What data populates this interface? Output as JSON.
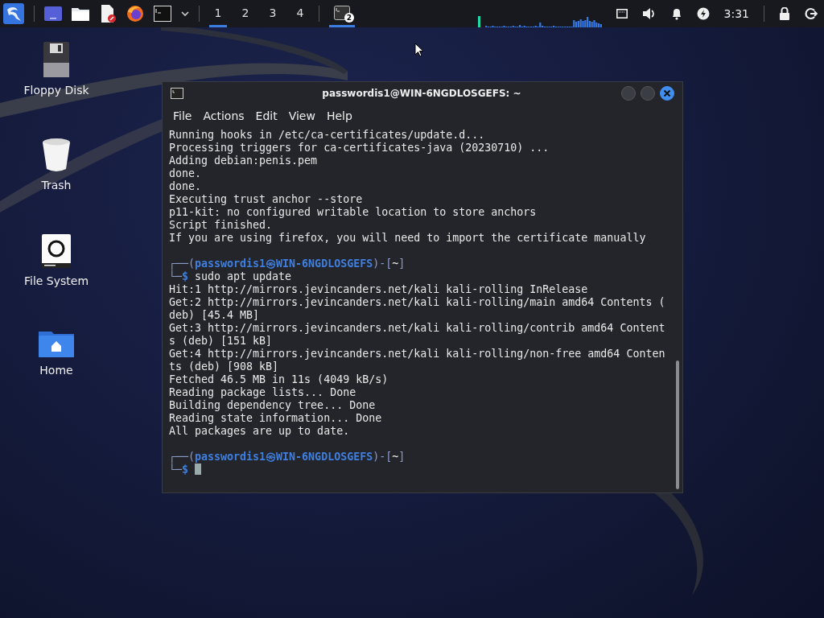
{
  "taskbar": {
    "workspaces": [
      {
        "label": "1",
        "selected": true
      },
      {
        "label": "2",
        "selected": false
      },
      {
        "label": "3",
        "selected": false
      },
      {
        "label": "4",
        "selected": false
      }
    ],
    "tasks": [
      {
        "badge": "2",
        "selected": true
      }
    ],
    "clock": "3:31"
  },
  "desktop_icons": [
    {
      "kind": "floppy",
      "label": "Floppy Disk"
    },
    {
      "kind": "trash",
      "label": "Trash"
    },
    {
      "kind": "drive",
      "label": "File System"
    },
    {
      "kind": "folder",
      "label": "Home"
    }
  ],
  "terminal": {
    "title": "passwordis1@WIN-6NGDLOSGEFS: ~",
    "menu": [
      "File",
      "Actions",
      "Edit",
      "View",
      "Help"
    ],
    "lines": [
      {
        "kind": "output",
        "text": "Running hooks in /etc/ca-certificates/update.d..."
      },
      {
        "kind": "output",
        "text": "Processing triggers for ca-certificates-java (20230710) ..."
      },
      {
        "kind": "output",
        "text": "Adding debian:penis.pem"
      },
      {
        "kind": "output",
        "text": "done."
      },
      {
        "kind": "output",
        "text": "done."
      },
      {
        "kind": "output",
        "text": "Executing trust anchor --store"
      },
      {
        "kind": "output",
        "text": "p11-kit: no configured writable location to store anchors"
      },
      {
        "kind": "output",
        "text": "Script finished."
      },
      {
        "kind": "output",
        "text": "If you are using firefox, you will need to import the certificate manually"
      },
      {
        "kind": "blank"
      },
      {
        "kind": "prompt",
        "open": "┌──(",
        "user": "passwordis1㉿WIN-6NGDLOSGEFS",
        "mid": ")-[",
        "dir": "~",
        "close": "]"
      },
      {
        "kind": "command",
        "lead": "└─",
        "sign": "$",
        "text": "sudo apt update"
      },
      {
        "kind": "output",
        "text": "Hit:1 http://mirrors.jevincanders.net/kali kali-rolling InRelease"
      },
      {
        "kind": "output",
        "text": "Get:2 http://mirrors.jevincanders.net/kali kali-rolling/main amd64 Contents (deb) [45.4 MB]"
      },
      {
        "kind": "output",
        "text": "Get:3 http://mirrors.jevincanders.net/kali kali-rolling/contrib amd64 Contents (deb) [151 kB]"
      },
      {
        "kind": "output",
        "text": "Get:4 http://mirrors.jevincanders.net/kali kali-rolling/non-free amd64 Contents (deb) [908 kB]"
      },
      {
        "kind": "output",
        "text": "Fetched 46.5 MB in 11s (4049 kB/s)"
      },
      {
        "kind": "output",
        "text": "Reading package lists... Done"
      },
      {
        "kind": "output",
        "text": "Building dependency tree... Done"
      },
      {
        "kind": "output",
        "text": "Reading state information... Done"
      },
      {
        "kind": "output",
        "text": "All packages are up to date."
      },
      {
        "kind": "blank"
      },
      {
        "kind": "prompt",
        "open": "┌──(",
        "user": "passwordis1㉿WIN-6NGDLOSGEFS",
        "mid": ")-[",
        "dir": "~",
        "close": "]"
      },
      {
        "kind": "input",
        "lead": "└─",
        "sign": "$"
      }
    ]
  }
}
